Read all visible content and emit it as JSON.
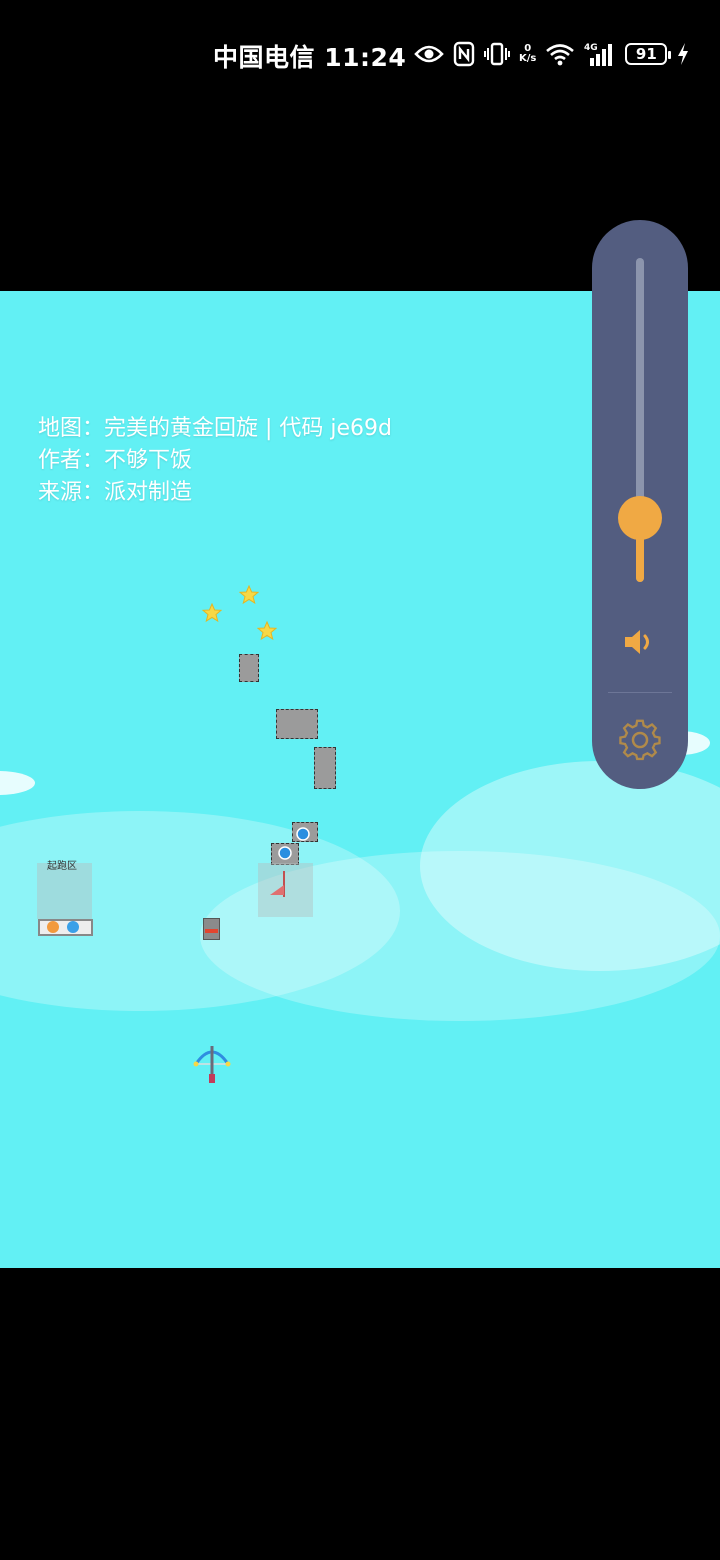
{
  "status_bar": {
    "carrier": "中国电信",
    "time": "11:24",
    "net_speed_value": "0",
    "net_speed_unit": "K/s",
    "network_type": "4G",
    "battery_level": "91"
  },
  "map_info": {
    "map_label": "地图：",
    "map_value": "完美的黄金回旋 | 代码 je69d",
    "author_label": "作者：",
    "author_value": "不够下饭",
    "source_label": "来源：",
    "source_value": "派对制造"
  },
  "level": {
    "start_zone_label": "起跑区",
    "star_count": 3
  },
  "volume_panel": {
    "volume_level": 0.2,
    "accent_color": "#f0a944",
    "panel_color": "#535d80",
    "icons": [
      "speaker-icon",
      "gear-icon"
    ]
  },
  "colors": {
    "sky": "#62f0f4",
    "status_bar_bg": "#000000"
  }
}
